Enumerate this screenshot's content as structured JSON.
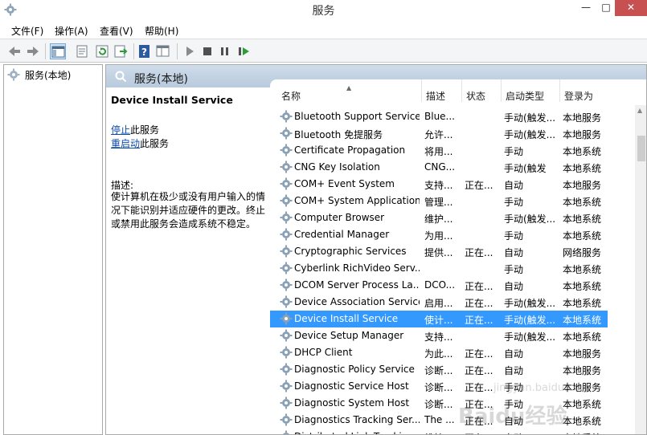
{
  "window": {
    "title": "服务",
    "min": "—",
    "max": "□",
    "close": "✕"
  },
  "menubar": [
    "文件(F)",
    "操作(A)",
    "查看(V)",
    "帮助(H)"
  ],
  "toolbar": [
    "back-arrow-icon",
    "forward-arrow-icon",
    "console-tree-icon",
    "properties-icon",
    "refresh-icon",
    "export-list-icon",
    "help-icon",
    "console-view-icon",
    "play-icon",
    "stop-icon",
    "pause-icon",
    "resume-icon"
  ],
  "tree": {
    "label": "服务(本地)"
  },
  "panel": {
    "header": "服务(本地)"
  },
  "detail": {
    "title": "Device Install Service",
    "stop_link": "停止",
    "stop_suffix": "此服务",
    "restart_link": "重启动",
    "restart_suffix": "此服务",
    "desc_label": "描述:",
    "desc_text": "使计算机在极少或没有用户输入的情况下能识别并适应硬件的更改。终止或禁用此服务会造成系统不稳定。"
  },
  "columns": {
    "name": "名称",
    "desc": "描述",
    "status": "状态",
    "start": "启动类型",
    "logon": "登录为"
  },
  "rows": [
    {
      "name": "Bluetooth Support Service",
      "desc": "Blue...",
      "status": "",
      "start": "手动(触发...",
      "logon": "本地服务"
    },
    {
      "name": "Bluetooth 免提服务",
      "desc": "允许...",
      "status": "",
      "start": "手动(触发...",
      "logon": "本地服务"
    },
    {
      "name": "Certificate Propagation",
      "desc": "将用...",
      "status": "",
      "start": "手动",
      "logon": "本地系统"
    },
    {
      "name": "CNG Key Isolation",
      "desc": "CNG...",
      "status": "",
      "start": "手动(触发",
      "logon": "本地系统"
    },
    {
      "name": "COM+ Event System",
      "desc": "支持...",
      "status": "正在...",
      "start": "自动",
      "logon": "本地服务"
    },
    {
      "name": "COM+ System Application",
      "desc": "管理...",
      "status": "",
      "start": "手动",
      "logon": "本地系统"
    },
    {
      "name": "Computer Browser",
      "desc": "维护...",
      "status": "",
      "start": "手动(触发...",
      "logon": "本地系统"
    },
    {
      "name": "Credential Manager",
      "desc": "为用...",
      "status": "",
      "start": "手动",
      "logon": "本地系统"
    },
    {
      "name": "Cryptographic Services",
      "desc": "提供...",
      "status": "正在...",
      "start": "自动",
      "logon": "网络服务"
    },
    {
      "name": "Cyberlink RichVideo Serv...",
      "desc": "",
      "status": "",
      "start": "手动",
      "logon": "本地系统"
    },
    {
      "name": "DCOM Server Process La...",
      "desc": "DCO...",
      "status": "正在...",
      "start": "自动",
      "logon": "本地系统"
    },
    {
      "name": "Device Association Service",
      "desc": "启用...",
      "status": "正在...",
      "start": "手动(触发...",
      "logon": "本地系统"
    },
    {
      "name": "Device Install Service",
      "desc": "使计...",
      "status": "正在...",
      "start": "手动(触发...",
      "logon": "本地系统",
      "selected": true
    },
    {
      "name": "Device Setup Manager",
      "desc": "支持...",
      "status": "",
      "start": "手动(触发...",
      "logon": "本地系统"
    },
    {
      "name": "DHCP Client",
      "desc": "为此...",
      "status": "正在...",
      "start": "自动",
      "logon": "本地服务"
    },
    {
      "name": "Diagnostic Policy Service",
      "desc": "诊断...",
      "status": "正在...",
      "start": "自动",
      "logon": "本地服务"
    },
    {
      "name": "Diagnostic Service Host",
      "desc": "诊断...",
      "status": "正在...",
      "start": "手动",
      "logon": "本地服务"
    },
    {
      "name": "Diagnostic System Host",
      "desc": "诊断...",
      "status": "正在...",
      "start": "手动",
      "logon": "本地系统"
    },
    {
      "name": "Diagnostics Tracking Ser...",
      "desc": "The ...",
      "status": "正在...",
      "start": "自动",
      "logon": "本地系统"
    },
    {
      "name": "Distributed Link Tracking...",
      "desc": "维护...",
      "status": "正在...",
      "start": "自动",
      "logon": "本地系统"
    }
  ],
  "watermark": {
    "text": "Baidu经验",
    "sub": "jingyan.baidu.com"
  },
  "colors": {
    "selection": "#3399ff",
    "link": "#0a4aa8",
    "header_band": "#c5d5e6"
  }
}
